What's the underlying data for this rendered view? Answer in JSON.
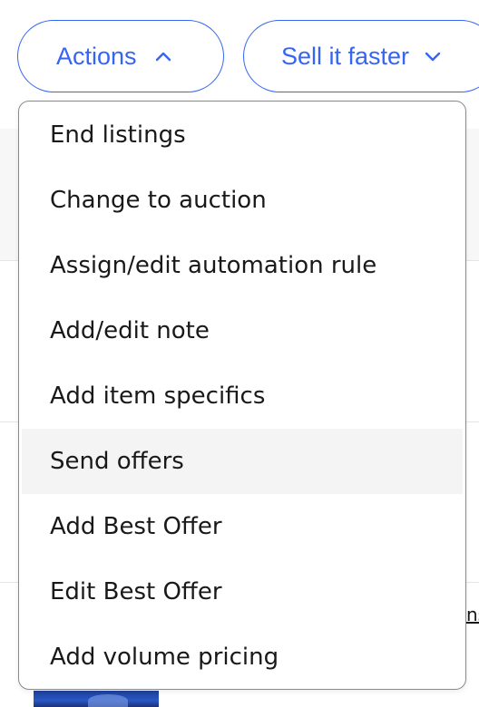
{
  "toolbar": {
    "actions_label": "Actions",
    "sell_faster_label": "Sell it faster"
  },
  "actions_menu": {
    "items": [
      {
        "label": "End listings"
      },
      {
        "label": "Change to auction"
      },
      {
        "label": "Assign/edit automation rule"
      },
      {
        "label": "Add/edit note"
      },
      {
        "label": "Add item specifics"
      },
      {
        "label": "Send offers"
      },
      {
        "label": "Add Best Offer"
      },
      {
        "label": "Edit Best Offer"
      },
      {
        "label": "Add volume pricing"
      }
    ],
    "highlighted_index": 5
  },
  "background": {
    "partial_link": "ns"
  },
  "icons": {
    "actions_chevron": "chevron-up-icon",
    "sell_faster_chevron": "chevron-down-icon"
  },
  "colors": {
    "accent": "#3665f3",
    "text": "#191919",
    "menu_border": "#8a8a8a",
    "hover_row": "#f4f4f4"
  }
}
